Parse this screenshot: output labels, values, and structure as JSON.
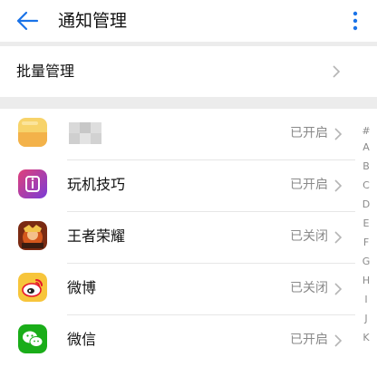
{
  "header": {
    "title": "通知管理",
    "back_icon": "arrow-left-icon",
    "more_icon": "more-vertical-icon",
    "accent": "#1a73e8"
  },
  "batch": {
    "label": "批量管理"
  },
  "apps": [
    {
      "name": "",
      "status": "已开启",
      "icon": "yellow-note-app-icon"
    },
    {
      "name": "玩机技巧",
      "status": "已开启",
      "icon": "tips-app-icon"
    },
    {
      "name": "王者荣耀",
      "status": "已关闭",
      "icon": "game-app-icon"
    },
    {
      "name": "微博",
      "status": "已关闭",
      "icon": "weibo-app-icon"
    },
    {
      "name": "微信",
      "status": "已开启",
      "icon": "wechat-app-icon"
    }
  ],
  "index_letters": [
    "#",
    "A",
    "B",
    "C",
    "D",
    "E",
    "F",
    "G",
    "H",
    "I",
    "J",
    "K"
  ],
  "colors": {
    "divider": "#ececec",
    "status_text": "#8a8a8a"
  }
}
